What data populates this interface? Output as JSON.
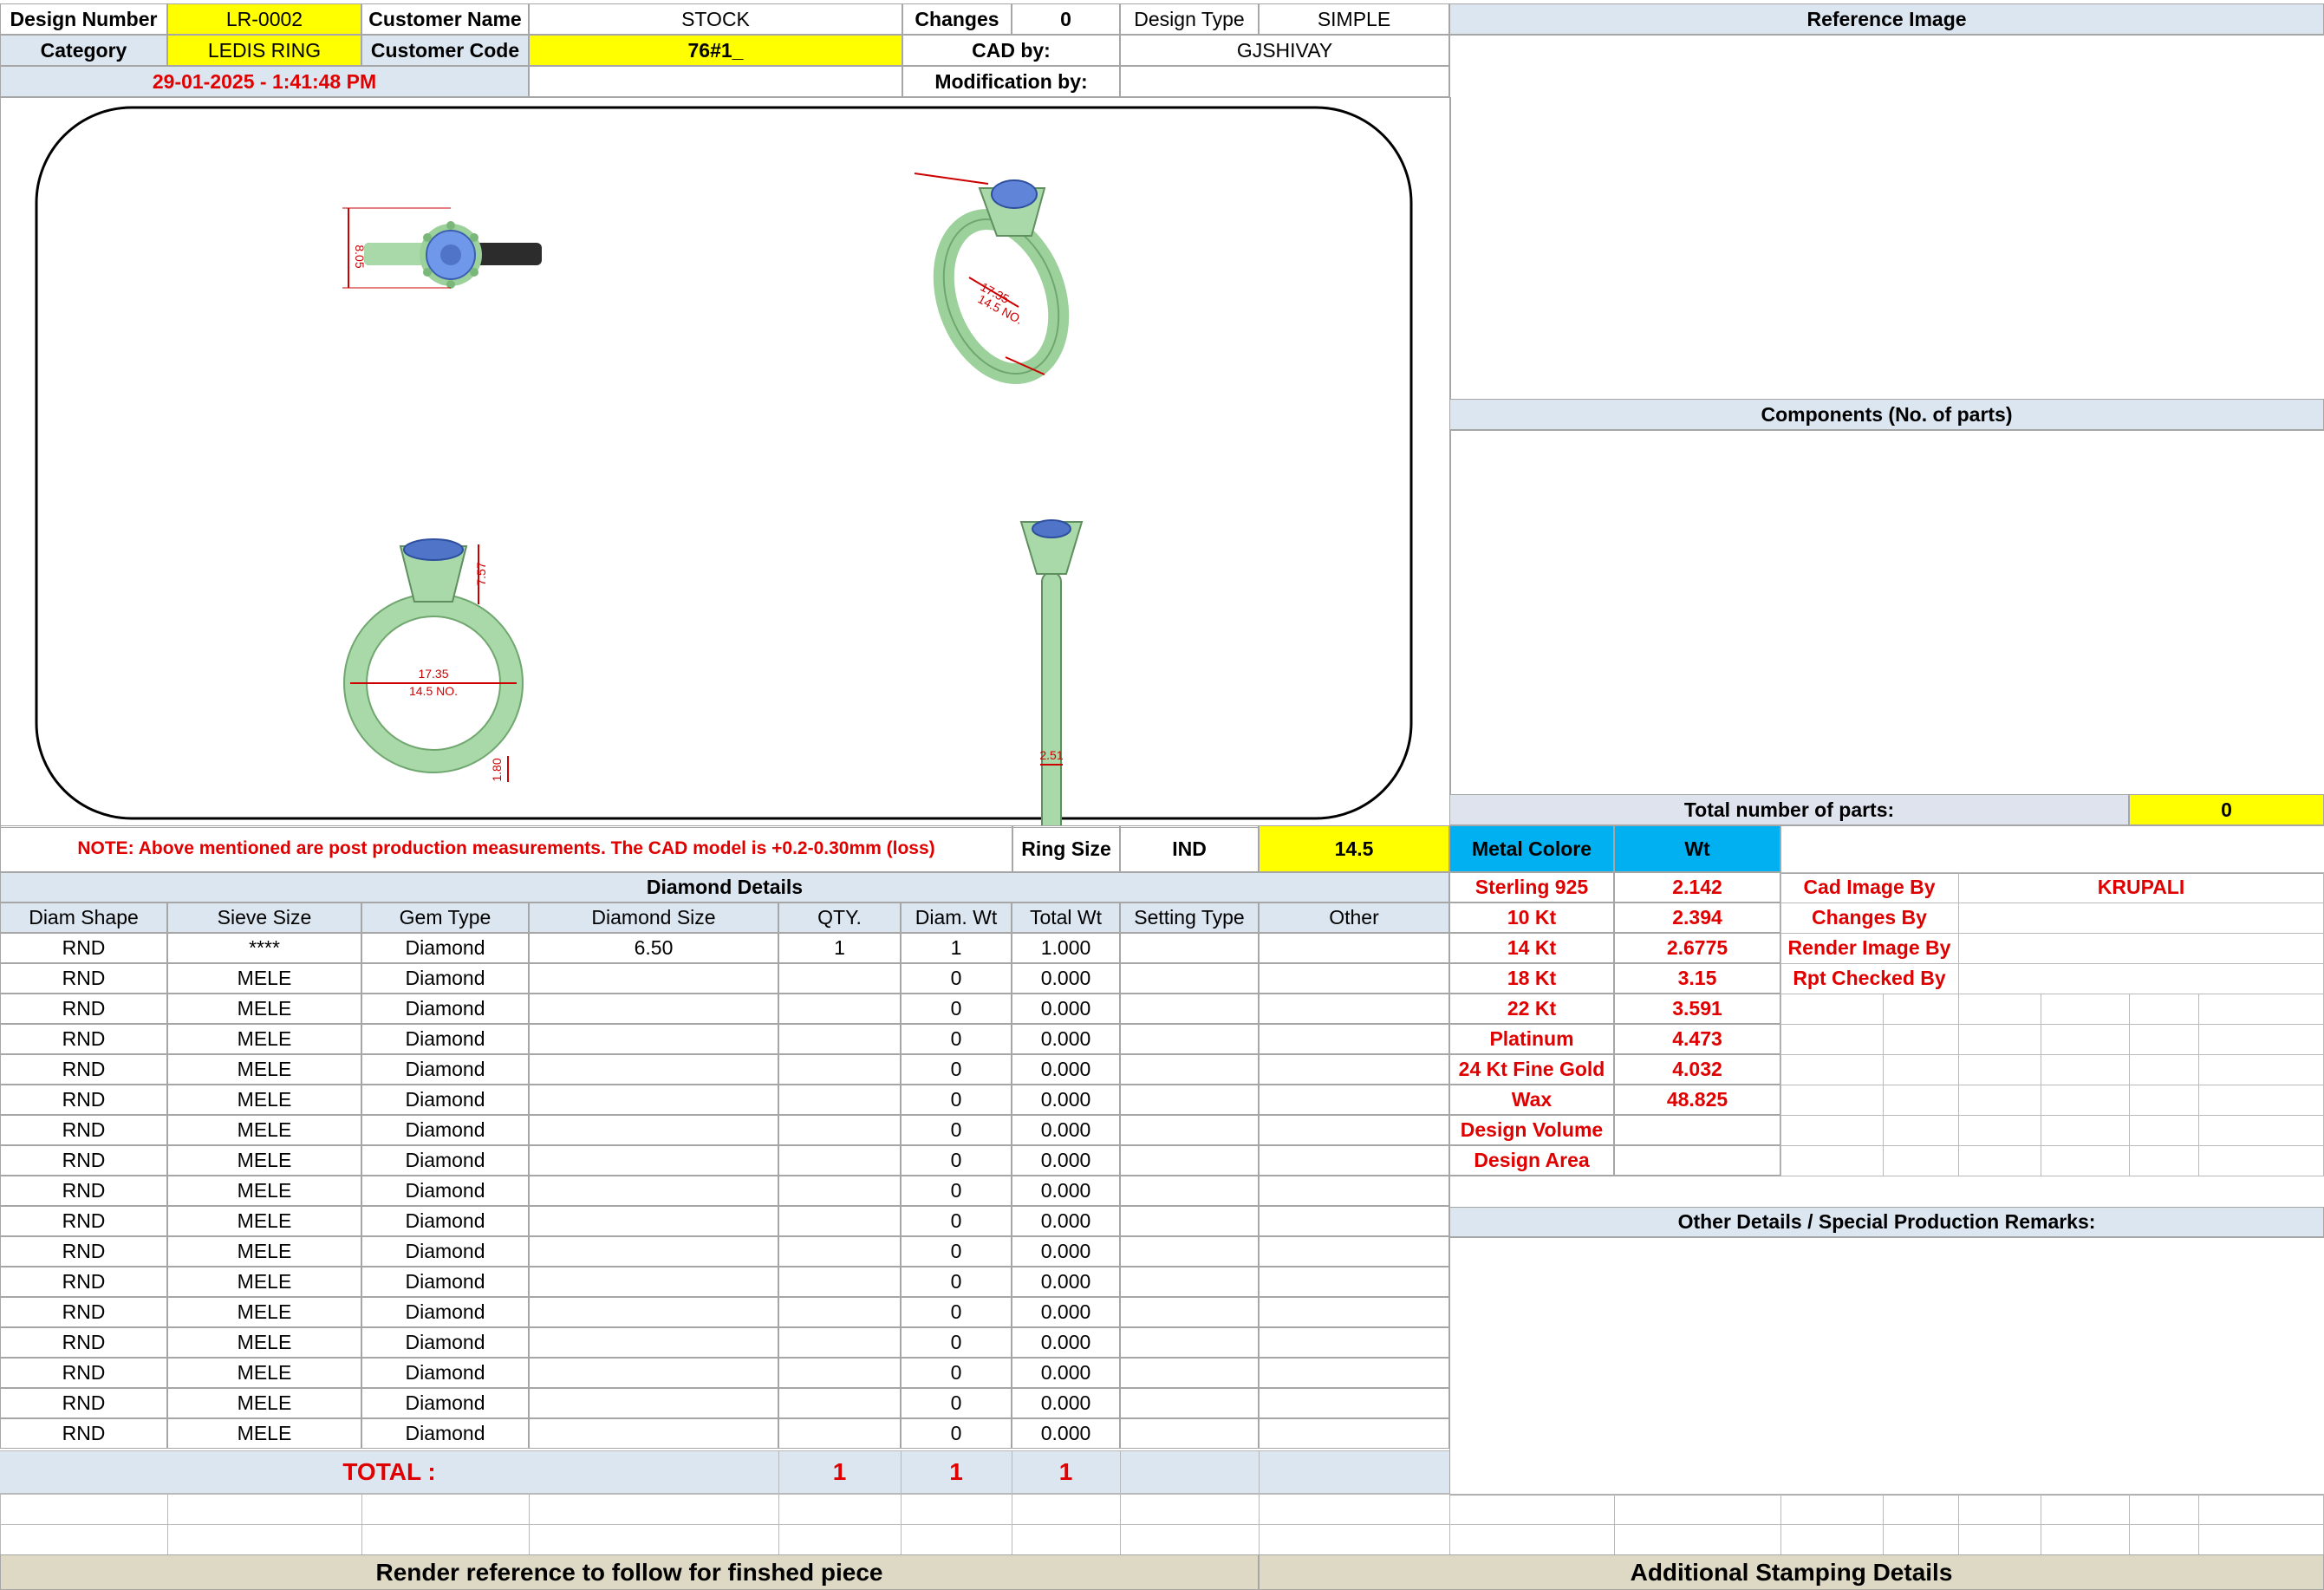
{
  "header": {
    "design_number_label": "Design Number",
    "design_number": "LR-0002",
    "customer_name_label": "Customer Name",
    "customer_name": "STOCK",
    "changes_label": "Changes",
    "changes": "0",
    "design_type_label": "Design Type",
    "design_type": "SIMPLE",
    "category_label": "Category",
    "category": "LEDIS RING",
    "customer_code_label": "Customer Code",
    "customer_code": "76#1_",
    "cad_by_label": "CAD by:",
    "cad_by": "GJSHIVAY",
    "datetime": "29-01-2025 - 1:41:48 PM",
    "modification_by_label": "Modification by:",
    "modification_by": ""
  },
  "drawing": {
    "dims": {
      "top_height": "8.05",
      "persp_diam": "17.35",
      "persp_size": "14.5 NO.",
      "front_head": "7.57",
      "front_diam": "17.35",
      "front_size": "14.5 NO.",
      "front_shank": "1.80",
      "side_width": "2.51"
    }
  },
  "right_panel": {
    "reference_image": "Reference Image",
    "components": "Components (No. of parts)",
    "total_parts_label": "Total number of parts:",
    "total_parts": "0"
  },
  "note": "NOTE: Above mentioned are post production measurements. The CAD model is +0.2-0.30mm (loss)",
  "ring_size": {
    "label": "Ring Size",
    "standard": "IND",
    "value": "14.5"
  },
  "metal": {
    "header_label": "Metal Colore",
    "header_wt": "Wt",
    "rows": [
      {
        "name": "Sterling 925",
        "wt": "2.142"
      },
      {
        "name": "10 Kt",
        "wt": "2.394"
      },
      {
        "name": "14 Kt",
        "wt": "2.6775"
      },
      {
        "name": "18 Kt",
        "wt": "3.15"
      },
      {
        "name": "22 Kt",
        "wt": "3.591"
      },
      {
        "name": "Platinum",
        "wt": "4.473"
      },
      {
        "name": "24 Kt Fine Gold",
        "wt": "4.032"
      },
      {
        "name": "Wax",
        "wt": "48.825"
      },
      {
        "name": "Design Volume",
        "wt": ""
      },
      {
        "name": "Design Area",
        "wt": ""
      }
    ]
  },
  "credits": {
    "cad_image_by_label": "Cad Image By",
    "cad_image_by": "KRUPALI",
    "changes_by_label": "Changes By",
    "render_image_by_label": "Render Image By",
    "rpt_checked_by_label": "Rpt Checked By"
  },
  "diamond": {
    "title": "Diamond Details",
    "columns": [
      "Diam Shape",
      "Sieve Size",
      "Gem Type",
      "Diamond Size",
      "QTY.",
      "Diam. Wt",
      "Total Wt",
      "Setting Type",
      "Other"
    ],
    "rows": [
      [
        "RND",
        "****",
        "Diamond",
        "6.50",
        "1",
        "1",
        "1.000",
        "",
        ""
      ],
      [
        "RND",
        "MELE",
        "Diamond",
        "",
        "",
        "0",
        "0.000",
        "",
        ""
      ],
      [
        "RND",
        "MELE",
        "Diamond",
        "",
        "",
        "0",
        "0.000",
        "",
        ""
      ],
      [
        "RND",
        "MELE",
        "Diamond",
        "",
        "",
        "0",
        "0.000",
        "",
        ""
      ],
      [
        "RND",
        "MELE",
        "Diamond",
        "",
        "",
        "0",
        "0.000",
        "",
        ""
      ],
      [
        "RND",
        "MELE",
        "Diamond",
        "",
        "",
        "0",
        "0.000",
        "",
        ""
      ],
      [
        "RND",
        "MELE",
        "Diamond",
        "",
        "",
        "0",
        "0.000",
        "",
        ""
      ],
      [
        "RND",
        "MELE",
        "Diamond",
        "",
        "",
        "0",
        "0.000",
        "",
        ""
      ],
      [
        "RND",
        "MELE",
        "Diamond",
        "",
        "",
        "0",
        "0.000",
        "",
        ""
      ],
      [
        "RND",
        "MELE",
        "Diamond",
        "",
        "",
        "0",
        "0.000",
        "",
        ""
      ],
      [
        "RND",
        "MELE",
        "Diamond",
        "",
        "",
        "0",
        "0.000",
        "",
        ""
      ],
      [
        "RND",
        "MELE",
        "Diamond",
        "",
        "",
        "0",
        "0.000",
        "",
        ""
      ],
      [
        "RND",
        "MELE",
        "Diamond",
        "",
        "",
        "0",
        "0.000",
        "",
        ""
      ],
      [
        "RND",
        "MELE",
        "Diamond",
        "",
        "",
        "0",
        "0.000",
        "",
        ""
      ],
      [
        "RND",
        "MELE",
        "Diamond",
        "",
        "",
        "0",
        "0.000",
        "",
        ""
      ],
      [
        "RND",
        "MELE",
        "Diamond",
        "",
        "",
        "0",
        "0.000",
        "",
        ""
      ],
      [
        "RND",
        "MELE",
        "Diamond",
        "",
        "",
        "0",
        "0.000",
        "",
        ""
      ]
    ],
    "total_label": "TOTAL :",
    "total_qty": "1",
    "total_diam_wt": "1",
    "total_wt": "1"
  },
  "other_details": "Other Details / Special Production Remarks:",
  "footer": {
    "render_reference": "Render reference to follow for finshed piece",
    "stamping": "Additional Stamping Details"
  }
}
